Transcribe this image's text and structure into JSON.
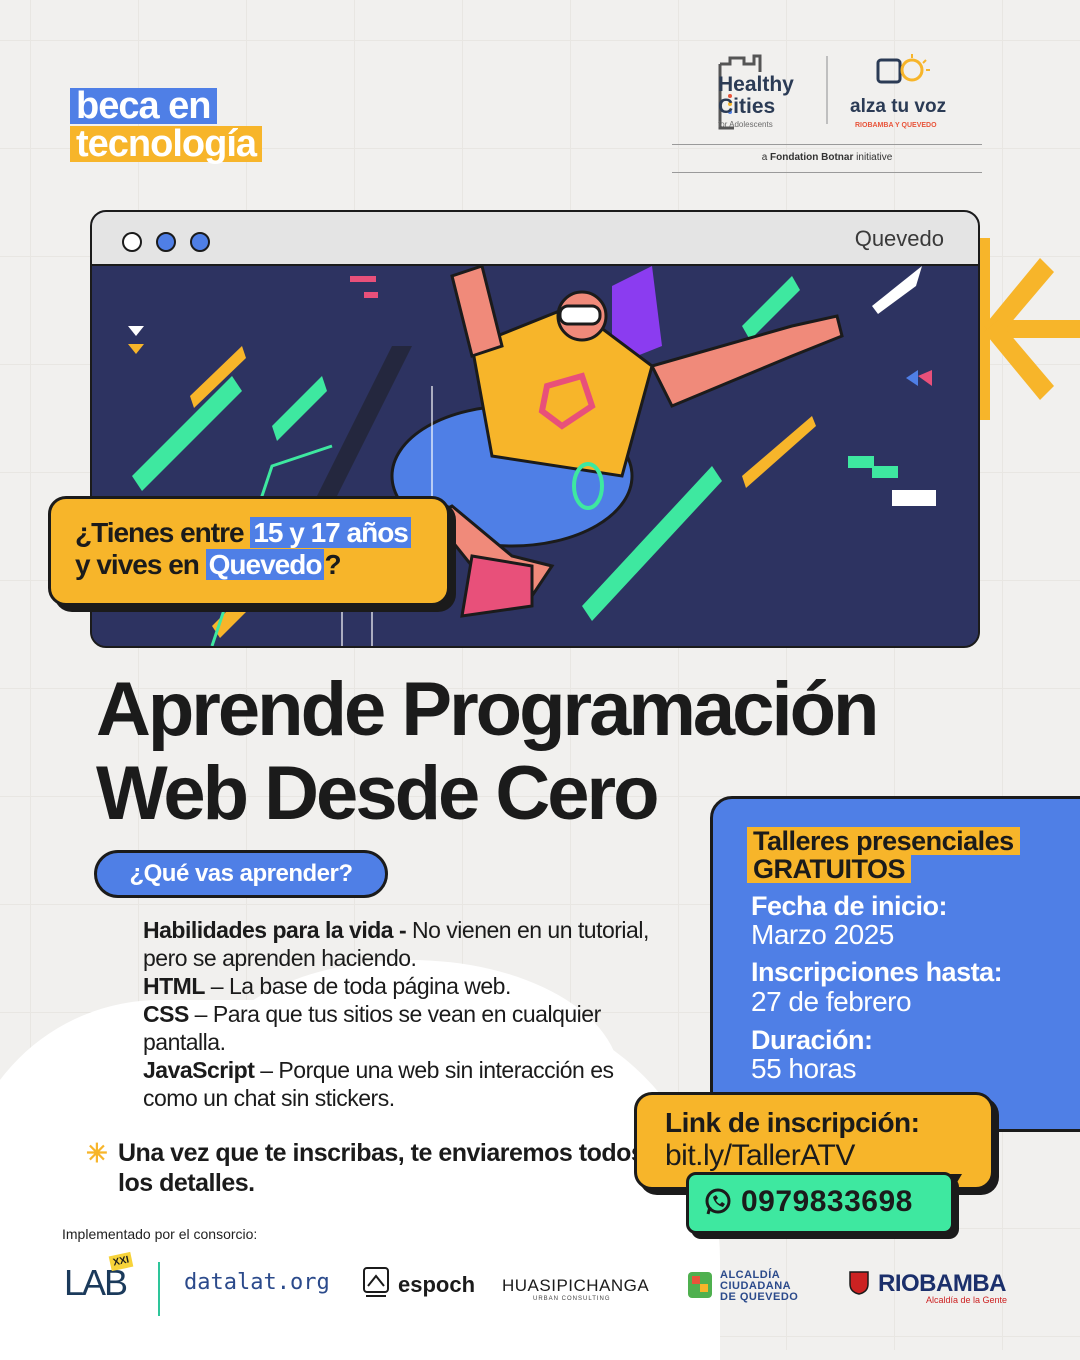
{
  "brand": {
    "line1": "beca en",
    "line2": "tecnología"
  },
  "partners": {
    "healthy_cities": "Healthy Cities",
    "healthy_cities_sub": "for Adolescents",
    "alza": "alza tu voz",
    "alza_sub": "RIOBAMBA Y QUEVEDO",
    "botnar_prefix": "a",
    "botnar_name": "Fondation Botnar",
    "botnar_suffix": "initiative"
  },
  "window": {
    "city": "Quevedo"
  },
  "question": {
    "line1_pre": "¿Tienes entre ",
    "line1_hl": "15 y 17 años",
    "line2_pre": "y vives en ",
    "line2_hl": "Quevedo",
    "line2_post": "?"
  },
  "headline": {
    "line1": "Aprende Programación",
    "line2": "Web Desde Cero"
  },
  "learn_pill": "¿Qué vas aprender?",
  "learn_items": [
    {
      "title": "Habilidades para la vida - ",
      "text": " No vienen en un tutorial, pero se aprenden haciendo."
    },
    {
      "title": "HTML",
      "text": " – La base de toda página web."
    },
    {
      "title": "CSS",
      "text": " – Para que tus sitios se vean en cualquier pantalla."
    },
    {
      "title": "JavaScript",
      "text": " – Porque una web sin interacción es como un chat sin stickers."
    }
  ],
  "note": "Una vez que te inscribas, te enviaremos todos los detalles.",
  "info": {
    "tag1": "Talleres presenciales",
    "tag2": "GRATUITOS",
    "start_label": "Fecha de inicio:",
    "start_value": "Marzo 2025",
    "deadline_label": "Inscripciones hasta:",
    "deadline_value": "27 de febrero",
    "duration_label": "Duración:",
    "duration_value": "55 horas"
  },
  "registration": {
    "label": "Link de inscripción:",
    "url": "bit.ly/TallerATV",
    "phone": "0979833698"
  },
  "footer": {
    "consortium": "Implementado por el consorcio:",
    "lab": "LAB",
    "lab_sup": "XXI",
    "datalat": "datalat.org",
    "espoch": "espoch",
    "huasipichanga": "HUASIPICHANGA",
    "huasipichanga_sub": "URBAN CONSULTING",
    "alcaldia": [
      "ALCALDÍA",
      "CIUDADANA",
      "DE QUEVEDO"
    ],
    "riobamba": "RIOBAMBA",
    "riobamba_sub": "Alcaldía de la Gente"
  },
  "colors": {
    "blue": "#4f7fe6",
    "yellow": "#f7b52a",
    "green": "#3ee8a0",
    "navy": "#2d3361",
    "ink": "#1b1b1b"
  }
}
